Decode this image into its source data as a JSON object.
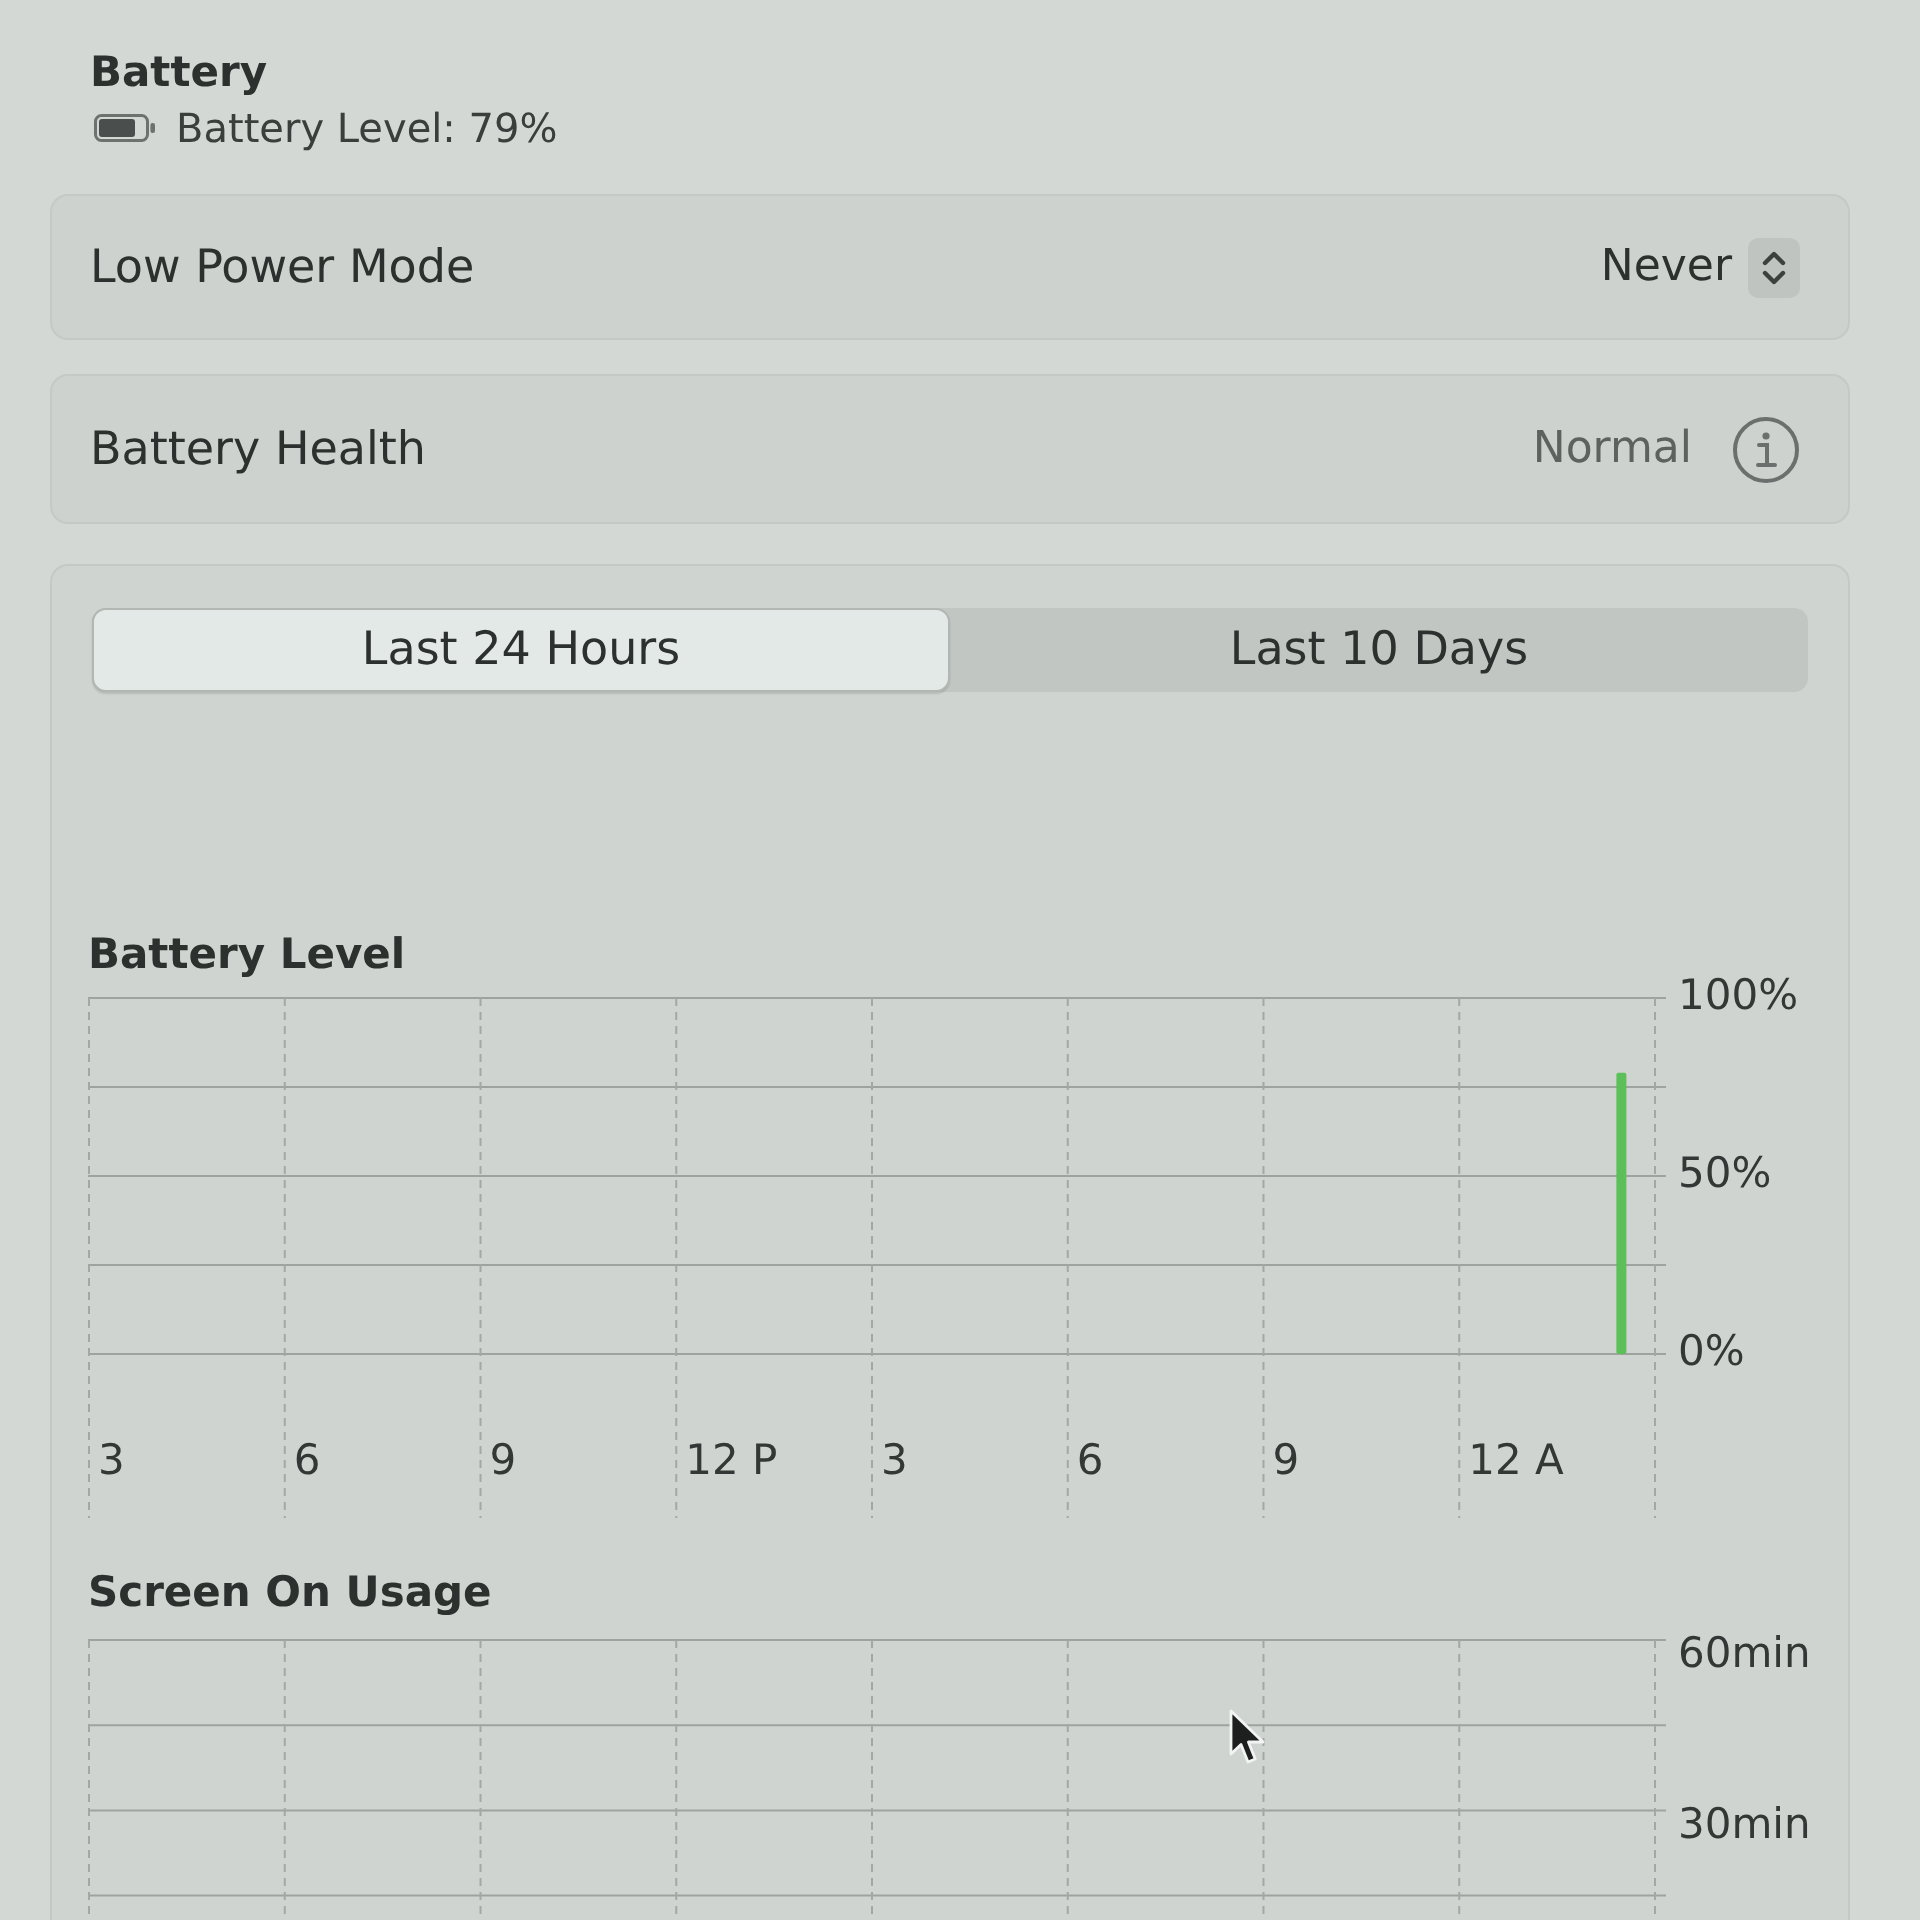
{
  "header": {
    "title": "Battery",
    "status": "Battery Level: 79%"
  },
  "settings": [
    {
      "kind": "popup",
      "label": "Low Power Mode",
      "value": "Never"
    },
    {
      "kind": "info",
      "label": "Battery Health",
      "value": "Normal"
    }
  ],
  "history": {
    "tabs": [
      {
        "label": "Last 24 Hours",
        "selected": true
      },
      {
        "label": "Last 10 Days",
        "selected": false
      }
    ],
    "charts": [
      {
        "chart_data": {
          "type": "bar",
          "title": "Battery Level",
          "categories": [
            "3",
            null,
            null,
            "6",
            null,
            null,
            "9",
            null,
            null,
            "12 P",
            null,
            null,
            "3",
            null,
            null,
            "6",
            null,
            null,
            "9",
            null,
            null,
            "12 A",
            null,
            null
          ],
          "series": [
            {
              "color": "#5cbf5a",
              "values": [
                null,
                null,
                null,
                null,
                null,
                null,
                null,
                null,
                null,
                null,
                null,
                null,
                null,
                null,
                null,
                null,
                null,
                null,
                null,
                null,
                null,
                null,
                null,
                79
              ]
            }
          ],
          "ylim": [
            0,
            100
          ],
          "yticks": [
            {
              "value": 100,
              "label": "100%"
            },
            {
              "value": 50,
              "label": "50%"
            },
            {
              "value": 0,
              "label": "0%"
            }
          ]
        }
      },
      {
        "chart_data": {
          "type": "bar",
          "title": "Screen On Usage",
          "categories": [
            null,
            null,
            null,
            null,
            null,
            null,
            null,
            null
          ],
          "ylim": [
            10,
            60
          ],
          "yticks": [
            {
              "value": 60,
              "label": "60min"
            },
            {
              "value": 30,
              "label": "30min"
            }
          ]
        }
      }
    ]
  }
}
